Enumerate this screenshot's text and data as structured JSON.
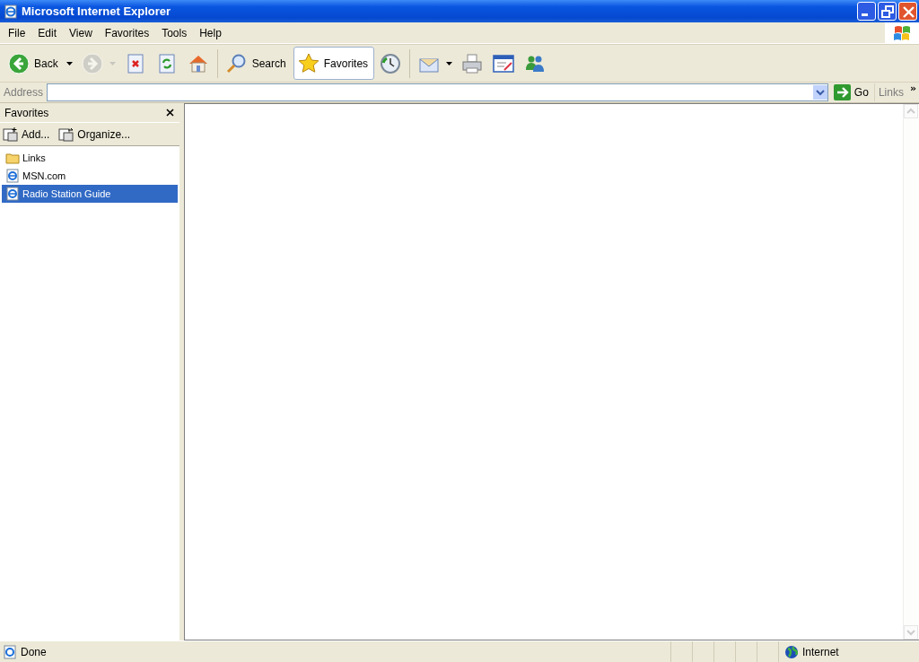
{
  "window": {
    "title": "Microsoft Internet Explorer"
  },
  "menu": [
    "File",
    "Edit",
    "View",
    "Favorites",
    "Tools",
    "Help"
  ],
  "toolbar": [
    {
      "kind": "back",
      "label": "Back",
      "dropdown": true,
      "pressed": false,
      "disabled": false
    },
    {
      "kind": "forward",
      "dropdown": true,
      "pressed": false,
      "disabled": true
    },
    {
      "kind": "stop",
      "pressed": false,
      "disabled": false
    },
    {
      "kind": "refresh",
      "pressed": false,
      "disabled": false
    },
    {
      "kind": "home",
      "pressed": false,
      "disabled": false
    },
    {
      "kind": "search",
      "label": "Search",
      "pressed": false,
      "disabled": false
    },
    {
      "kind": "favorites",
      "label": "Favorites",
      "pressed": true,
      "disabled": false
    },
    {
      "kind": "history",
      "pressed": false,
      "disabled": false
    },
    {
      "kind": "mail",
      "dropdown": true,
      "pressed": false,
      "disabled": false
    },
    {
      "kind": "print",
      "pressed": false,
      "disabled": false
    },
    {
      "kind": "edit",
      "pressed": false,
      "disabled": false
    },
    {
      "kind": "messenger",
      "pressed": false,
      "disabled": false
    }
  ],
  "address": {
    "label": "Address",
    "go": "Go",
    "links": "Links",
    "more": "»"
  },
  "favorites_pane": {
    "title": "Favorites",
    "buttons": [
      {
        "kind": "add",
        "label": "Add..."
      },
      {
        "kind": "organize",
        "label": "Organize..."
      }
    ],
    "items": [
      {
        "kind": "folder",
        "label": "Links",
        "selected": false
      },
      {
        "kind": "page",
        "label": "MSN.com",
        "selected": false
      },
      {
        "kind": "page",
        "label": "Radio Station Guide",
        "selected": true
      }
    ]
  },
  "status_bar": {
    "text": "Done",
    "zone": "Internet"
  }
}
